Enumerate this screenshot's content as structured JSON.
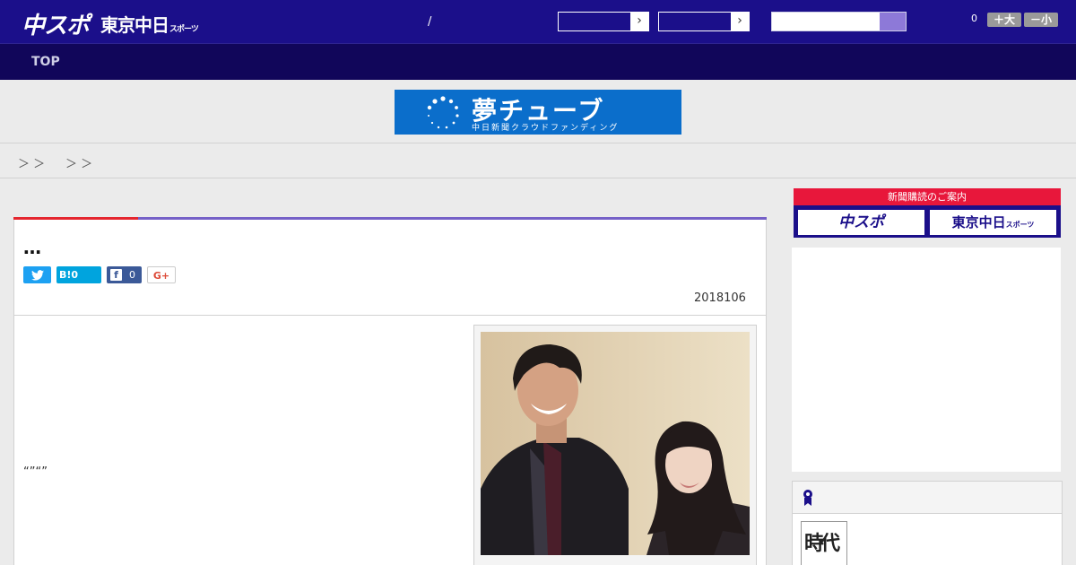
{
  "header": {
    "logo_chuspo": "中スポ",
    "logo_tokyo": "東京中日",
    "logo_tokyo_suffix": "スポーツ",
    "separator": "/",
    "select_arrow_1": "›",
    "select_arrow_2": "›",
    "font_count": "0",
    "font_larger": "＋大",
    "font_smaller": "－小"
  },
  "nav": {
    "top_label": "TOP"
  },
  "banner": {
    "title": "夢チューブ",
    "subtitle": "中日新聞クラウドファンディング"
  },
  "breadcrumb": {
    "sep_1": "＞ ＞",
    "sep_2": "＞ ＞"
  },
  "article": {
    "title": "…",
    "share": {
      "twitter_icon": "twitter-bird",
      "hatena_label": "B!0",
      "facebook_icon": "f",
      "facebook_count": "0",
      "gplus_label": "G+"
    },
    "date": "2018106",
    "body": "“”“”"
  },
  "sidebar": {
    "subscribe_heading": "新聞購読のご案内",
    "subscribe_chuspo": "中スポ",
    "subscribe_tokyo": "東京中日",
    "subscribe_tokyo_suffix": "スポーツ",
    "book_title": "時代"
  },
  "colors": {
    "header_bg": "#1b0f8a",
    "nav_bg": "#11065a",
    "accent_red": "#e4262f",
    "accent_purple": "#7560c7",
    "banner_blue": "#0b6ecb"
  }
}
